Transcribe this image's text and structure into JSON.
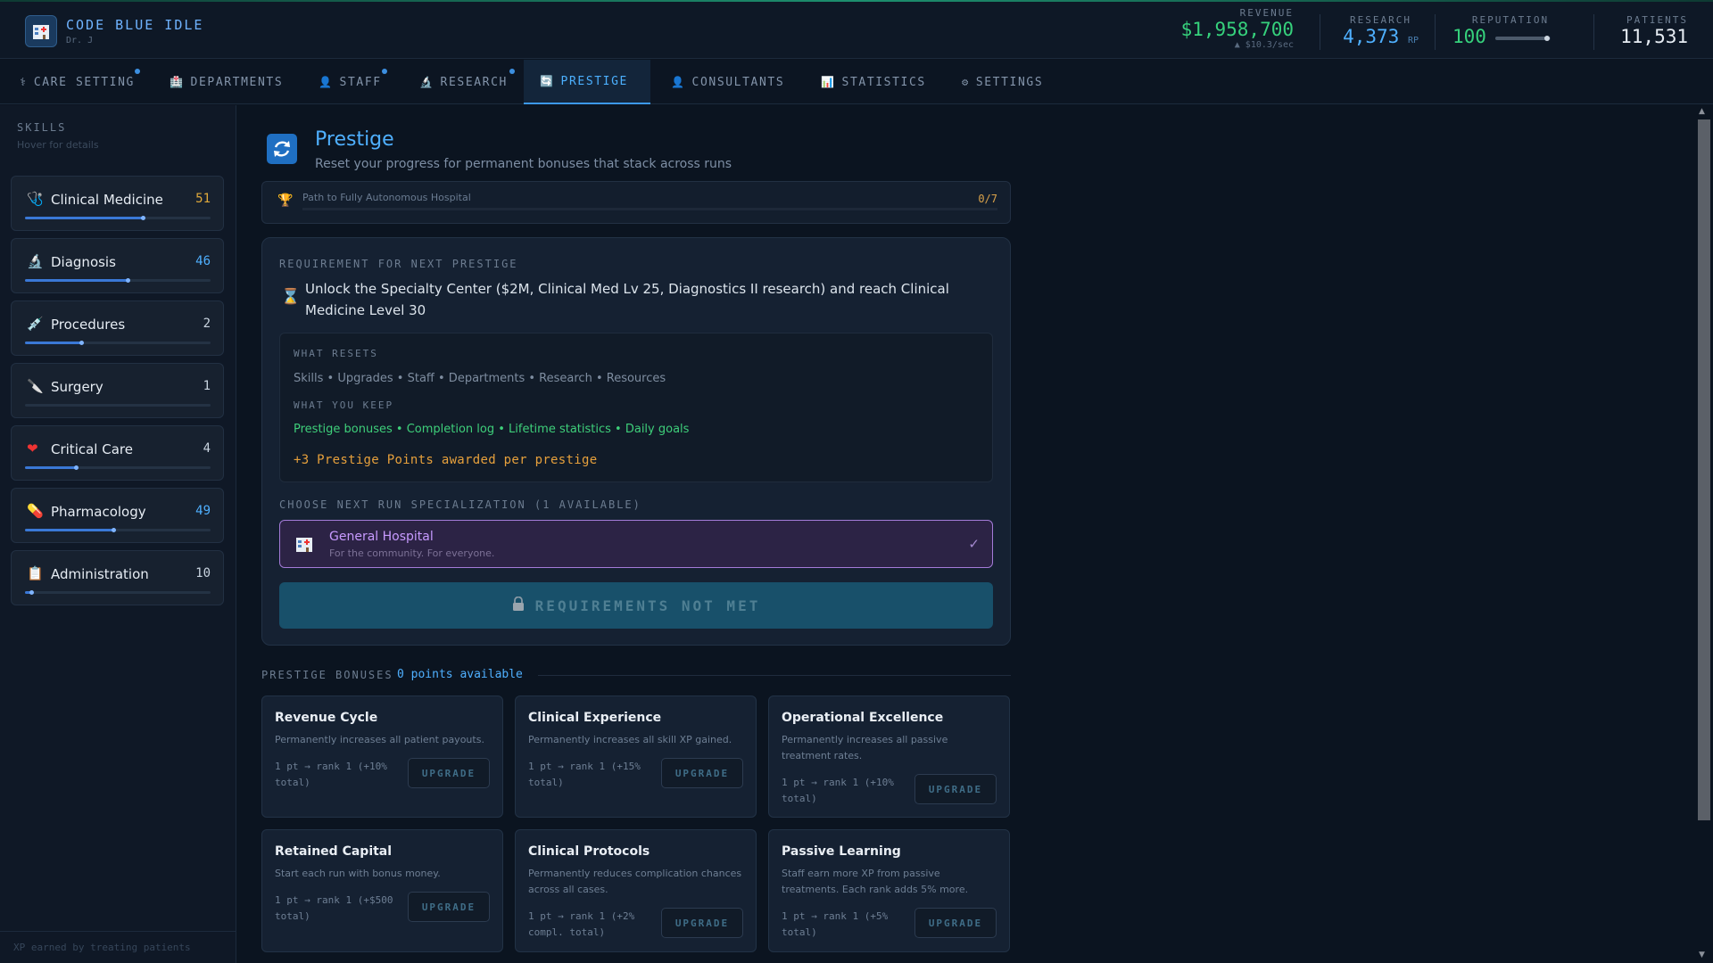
{
  "header": {
    "app_title": "CODE BLUE IDLE",
    "user": "Dr. J",
    "revenue_label": "REVENUE",
    "revenue_value": "$1,958,700",
    "revenue_rate": "▲ $10.3/sec",
    "research_label": "RESEARCH",
    "research_value": "4,373",
    "research_unit": "RP",
    "reputation_label": "REPUTATION",
    "reputation_value": "100",
    "reputation_fill": 0.95,
    "patients_label": "PATIENTS",
    "patients_value": "11,531"
  },
  "tabs": [
    {
      "label": "CARE SETTING",
      "icon": "⚕"
    },
    {
      "label": "DEPARTMENTS",
      "icon": "🏥"
    },
    {
      "label": "STAFF",
      "icon": "👤"
    },
    {
      "label": "RESEARCH",
      "icon": "🔬"
    },
    {
      "label": "PRESTIGE",
      "icon": "🔄"
    },
    {
      "label": "CONSULTANTS",
      "icon": "👤"
    },
    {
      "label": "STATISTICS",
      "icon": "📊"
    },
    {
      "label": "SETTINGS",
      "icon": "⚙"
    }
  ],
  "sidebar": {
    "title": "SKILLS",
    "hint": "Hover for details",
    "footer": "XP earned by treating patients",
    "skills": [
      {
        "name": "Clinical Medicine",
        "level": "51",
        "icon": "🩺",
        "progress": 0.64,
        "level_color": "#e0a93b"
      },
      {
        "name": "Diagnosis",
        "level": "46",
        "icon": "🔬",
        "progress": 0.56,
        "level_color": "#4fb0ff"
      },
      {
        "name": "Procedures",
        "level": "2",
        "icon": "💉",
        "progress": 0.31,
        "level_color": "#c9d4e0"
      },
      {
        "name": "Surgery",
        "level": "1",
        "icon": "🔪",
        "progress": 0.0,
        "level_color": "#c9d4e0"
      },
      {
        "name": "Critical Care",
        "level": "4",
        "icon": "❤",
        "progress": 0.28,
        "level_color": "#c9d4e0"
      },
      {
        "name": "Pharmacology",
        "level": "49",
        "icon": "💊",
        "progress": 0.48,
        "level_color": "#4fb0ff"
      },
      {
        "name": "Administration",
        "level": "10",
        "icon": "📋",
        "progress": 0.04,
        "level_color": "#c9d4e0"
      }
    ]
  },
  "prestige": {
    "title": "Prestige",
    "subtitle": "Reset your progress for permanent bonuses that stack across runs",
    "path_label": "Path to Fully Autonomous Hospital",
    "path_count": "0/7",
    "req_label": "REQUIREMENT FOR NEXT PRESTIGE",
    "req_text": "Unlock the Specialty Center ($2M, Clinical Med Lv 25, Diagnostics II research) and reach Clinical Medicine Level 30",
    "what_resets_label": "WHAT RESETS",
    "what_resets": "Skills • Upgrades • Staff • Departments • Research • Resources",
    "what_keep_label": "WHAT YOU KEEP",
    "what_keep": "Prestige bonuses • Completion log • Lifetime statistics • Daily goals",
    "points_award": "+3 Prestige Points awarded per prestige",
    "choose_label": "CHOOSE NEXT RUN SPECIALIZATION (1 AVAILABLE)",
    "spec_name": "General Hospital",
    "spec_desc": "For the community. For everyone.",
    "spec_check": "✓",
    "button_label": "REQUIREMENTS NOT MET"
  },
  "bonuses": {
    "label": "PRESTIGE BONUSES",
    "points": "0 points available",
    "upgrade_label": "UPGRADE",
    "cards": [
      {
        "title": "Revenue Cycle",
        "desc": "Permanently increases all patient payouts.",
        "rank": "1 pt → rank 1 (+10% total)"
      },
      {
        "title": "Clinical Experience",
        "desc": "Permanently increases all skill XP gained.",
        "rank": "1 pt → rank 1 (+15% total)"
      },
      {
        "title": "Operational Excellence",
        "desc": "Permanently increases all passive treatment rates.",
        "rank": "1 pt → rank 1 (+10% total)"
      },
      {
        "title": "Retained Capital",
        "desc": "Start each run with bonus money.",
        "rank": "1 pt → rank 1 (+$500 total)"
      },
      {
        "title": "Clinical Protocols",
        "desc": "Permanently reduces complication chances across all cases.",
        "rank": "1 pt → rank 1 (+2% compl. total)"
      },
      {
        "title": "Passive Learning",
        "desc": "Staff earn more XP from passive treatments. Each rank adds 5% more.",
        "rank": "1 pt → rank 1 (+5% total)"
      }
    ]
  }
}
